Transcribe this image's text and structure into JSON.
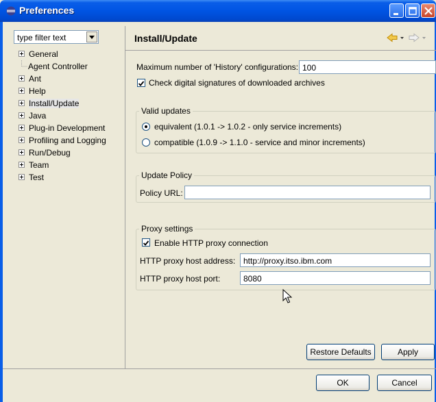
{
  "window": {
    "title": "Preferences"
  },
  "filter": {
    "text": "type filter text"
  },
  "tree": {
    "items": [
      {
        "label": "General",
        "expandable": true
      },
      {
        "label": "Agent Controller",
        "expandable": false
      },
      {
        "label": "Ant",
        "expandable": true
      },
      {
        "label": "Help",
        "expandable": true
      },
      {
        "label": "Install/Update",
        "expandable": true,
        "selected": true
      },
      {
        "label": "Java",
        "expandable": true
      },
      {
        "label": "Plug-in Development",
        "expandable": true
      },
      {
        "label": "Profiling and Logging",
        "expandable": true
      },
      {
        "label": "Run/Debug",
        "expandable": true
      },
      {
        "label": "Team",
        "expandable": true
      },
      {
        "label": "Test",
        "expandable": true
      }
    ]
  },
  "page": {
    "title": "Install/Update",
    "history_label": "Maximum number of 'History' configurations:",
    "history_value": "100",
    "check_signatures_label": "Check digital signatures of downloaded archives",
    "check_signatures_checked": true
  },
  "valid_updates": {
    "title": "Valid updates",
    "equivalent_label": "equivalent (1.0.1 -> 1.0.2 - only service increments)",
    "compatible_label": "compatible (1.0.9 -> 1.1.0 - service and minor increments)",
    "selected": "equivalent"
  },
  "update_policy": {
    "title": "Update Policy",
    "url_label": "Policy URL:",
    "url_value": ""
  },
  "proxy": {
    "title": "Proxy settings",
    "enable_label": "Enable HTTP proxy connection",
    "enable_checked": true,
    "host_label": "HTTP proxy host address:",
    "host_value": "http://proxy.itso.ibm.com",
    "port_label": "HTTP proxy host port:",
    "port_value": "8080"
  },
  "buttons": {
    "restore_defaults": "Restore Defaults",
    "apply": "Apply",
    "ok": "OK",
    "cancel": "Cancel"
  },
  "icons": {
    "back": "back-arrow-icon",
    "forward": "forward-arrow-icon",
    "menu": "view-menu-icon"
  },
  "colors": {
    "titlebar": "#0054e3",
    "nav_arrow": "#e8a000"
  }
}
